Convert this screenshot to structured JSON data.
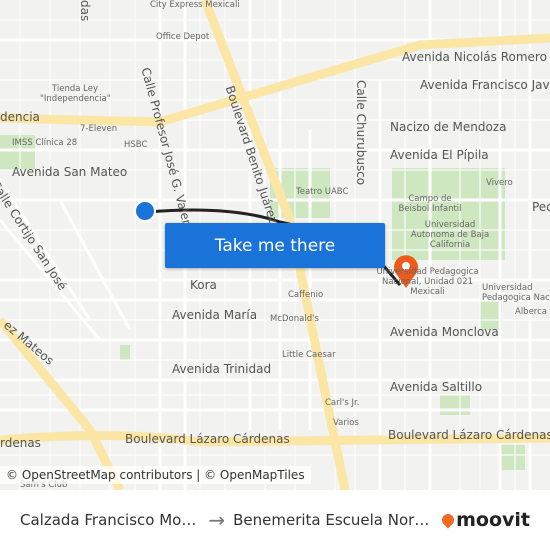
{
  "map": {
    "streets": [
      "Avenida Nicolás Romero",
      "Avenida Francisco Javier",
      "Nacizo de Mendoza",
      "Avenida El Pípila",
      "Avenida San Mateo",
      "Calle Cortijo San José",
      "Calle Profesor José G. Valenzuela",
      "Boulevard Benito Juárez",
      "Calle Churubusco",
      "Kora",
      "Avenida María",
      "Avenida Trinidad",
      "Avenida Monclova",
      "Avenida Saltillo",
      "Boulevard Lázaro Cárdenas",
      "Boulevard Lázaro Cárdenas",
      "rdenas",
      "dencia",
      "ez Mateos",
      "das",
      "Ped"
    ],
    "pois": [
      "City Express Mexicali",
      "Office Depot",
      "Tienda Ley \"Independencia\"",
      "7-Eleven",
      "HSBC",
      "IMSS Clínica 28",
      "Teatro UABC",
      "Campo de Beisbol Infantil",
      "Universidad Autonoma de Baja California",
      "Vivero",
      "Universidad Pedagogica Nacional, Unidad 021 Mexicali",
      "Universidad Pedagogica Nac",
      "Alberca U",
      "Caffenio",
      "McDonald's",
      "Little Caesar",
      "Carl's Jr.",
      "Varios",
      "Sam's Club"
    ],
    "cta": "Take me there",
    "attribution": "© OpenStreetMap contributors | © OpenMapTiles",
    "route_color": "#222222",
    "origin_color": "#1a73d9",
    "dest_color": "#f05a1a"
  },
  "footer": {
    "origin": "Calzada Francisco Mo…",
    "destination": "Benemerita Escuela Nor…",
    "brand": "moovit",
    "brand_color": "#f26b21"
  }
}
